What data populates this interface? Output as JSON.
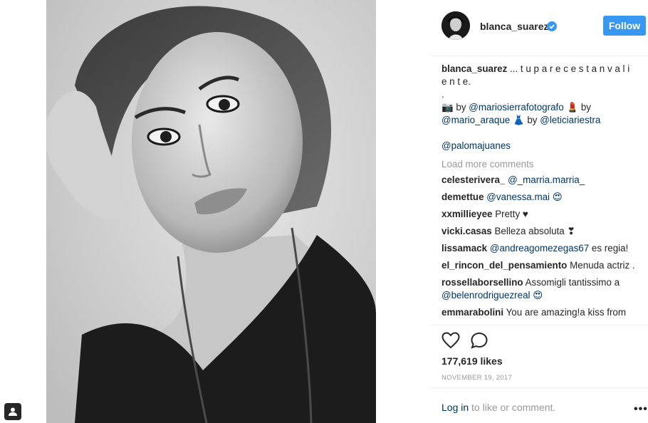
{
  "post": {
    "username": "blanca_suarez",
    "follow_label": "Follow",
    "caption_user": "blanca_suarez",
    "caption_lines": [
      "... t u p a r e c e s t a n v a l i",
      "e n t e.",
      ".",
      "📷 by",
      "@mariosierrafotografo",
      "💄 by",
      "@mario_araque",
      "👗 by",
      "@leticiariestra",
      "@palomajuanes"
    ],
    "load_more": "Load more comments",
    "comments": [
      {
        "user": "celesterivera_",
        "text": "@_marria.marria_"
      },
      {
        "user": "demettue",
        "text": "@vanessa.mai 😍"
      },
      {
        "user": "xxmillieyee",
        "text": "Pretty ♥"
      },
      {
        "user": "vicki.casas",
        "text": "Belleza absoluta ❣"
      },
      {
        "user": "lissamack",
        "text": "@andreagomezegas67",
        "text2": "es regia!"
      },
      {
        "user": "el_rincon_del_pensamiento",
        "text": "Menuda actriz ."
      },
      {
        "user": "rossellaborsellino",
        "text": "Assomigli tantissimo a",
        "text2": "@belenrodriguezreal 😍"
      },
      {
        "user": "emmarabolini",
        "text": "You are amazing!a kiss from"
      }
    ],
    "likes": "177,619 likes",
    "date": "NOVEMBER 19, 2017",
    "login_link": "Log in",
    "login_rest": " to like or comment.",
    "more_label": "•••"
  },
  "icons": {
    "heart": "heart-icon",
    "comment": "comment-icon",
    "verified": "verified-badge-icon",
    "more": "more-options-icon",
    "tag": "user-tag-icon"
  },
  "colors": {
    "follow": "#3897f0",
    "link": "#003569",
    "muted": "#999999",
    "text": "#262626"
  }
}
